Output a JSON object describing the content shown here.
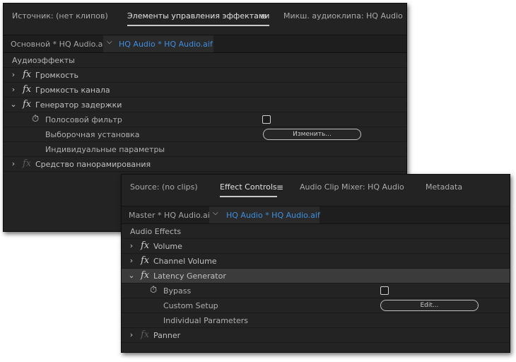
{
  "russian_panel": {
    "tabs": {
      "source": "Источник: (нет клипов)",
      "effect_controls": "Элементы управления эффектами",
      "audio_clip_mixer": "Микш. аудиоклипа: HQ Audio"
    },
    "menu_icon": "≡",
    "clip_bar": {
      "master": "Основной * HQ Audio.aif",
      "chevron": "⌵",
      "sequence": "HQ Audio * HQ Audio.aif"
    },
    "section_header": "Аудиоэффекты",
    "effects": {
      "volume": "Громкость",
      "channel_volume": "Громкость канала",
      "latency_generator": "Генератор задержки",
      "panner": "Средство панорамирования"
    },
    "params": {
      "bypass": "Полосовой фильтр",
      "custom_setup": "Выборочная установка",
      "edit_button": "Изменить...",
      "individual_params": "Индивидуальные параметры"
    }
  },
  "english_panel": {
    "tabs": {
      "source": "Source: (no clips)",
      "effect_controls": "Effect Controls",
      "audio_clip_mixer": "Audio Clip Mixer: HQ Audio",
      "metadata": "Metadata"
    },
    "menu_icon": "≡",
    "clip_bar": {
      "master": "Master * HQ Audio.aif",
      "chevron": "⌵",
      "sequence": "HQ Audio * HQ Audio.aif"
    },
    "section_header": "Audio Effects",
    "effects": {
      "volume": "Volume",
      "channel_volume": "Channel Volume",
      "latency_generator": "Latency Generator",
      "panner": "Panner"
    },
    "params": {
      "bypass": "Bypass",
      "custom_setup": "Custom Setup",
      "edit_button": "Edit...",
      "individual_params": "Individual Parameters"
    }
  },
  "glyphs": {
    "collapsed": "›",
    "expanded": "⌄",
    "fx": "fx",
    "stopwatch": "⏱"
  },
  "icons": [
    "hamburger-menu-icon",
    "chevron-down-icon",
    "chevron-right-icon",
    "fx-icon",
    "stopwatch-icon"
  ],
  "colors": {
    "panel_bg": "#232323",
    "highlight_row": "#3b3b3b",
    "accent_blue": "#3f8fe0",
    "text": "#c0c0c0"
  }
}
